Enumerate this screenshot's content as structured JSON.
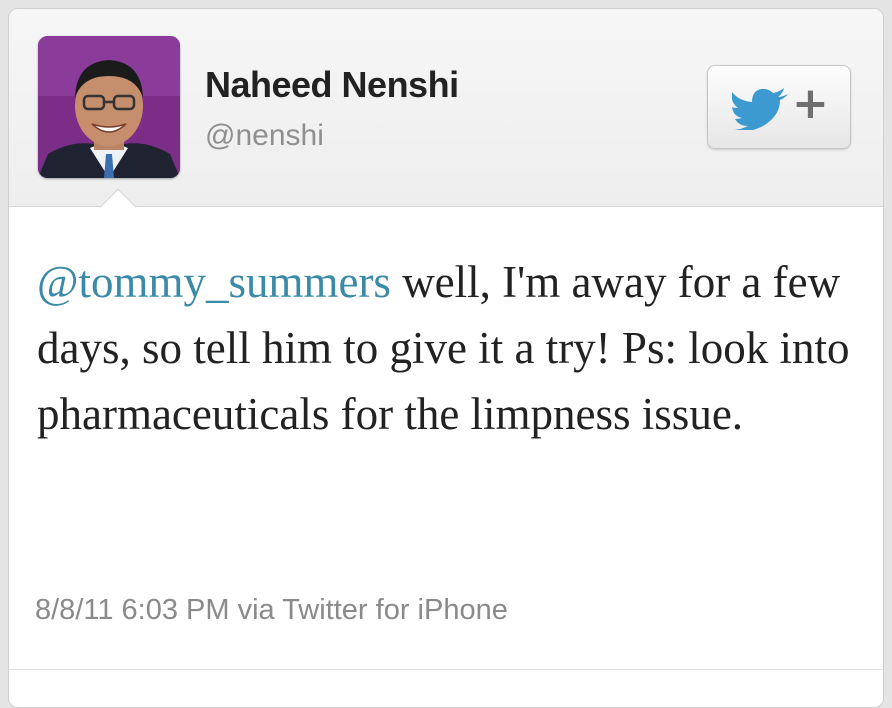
{
  "tweet": {
    "author_name": "Naheed Nenshi",
    "author_handle": "@nenshi",
    "mention": "@tommy_summers",
    "body": " well, I'm away for a few days, so tell him to give it a try! Ps: look into pharmaceuticals for the limpness issue.",
    "timestamp": "8/8/11 6:03 PM via Twitter for iPhone"
  },
  "follow_button": {
    "icon": "twitter-bird-icon",
    "plus": "+"
  },
  "colors": {
    "mention": "#3a8aa8",
    "bird": "#3d9ad1",
    "avatar_bg": "#7a2e88"
  }
}
